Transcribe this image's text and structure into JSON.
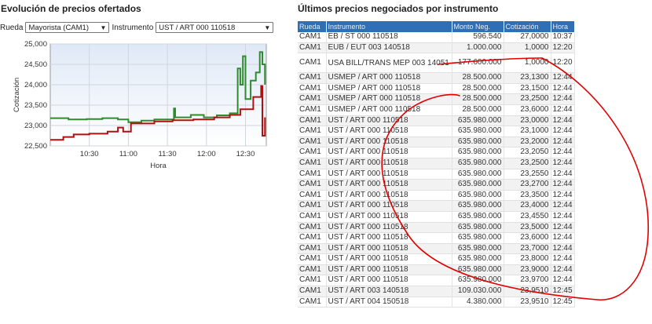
{
  "left_panel": {
    "title": "Evolución de precios ofertados",
    "rueda_label": "Rueda",
    "rueda_value": "Mayorista (CAM1)",
    "instrumento_label": "Instrumento",
    "instrumento_value": "UST / ART 000 110518"
  },
  "right_panel": {
    "title": "Últimos precios negociados por instrumento"
  },
  "chart_data": {
    "type": "line",
    "title": "",
    "xlabel": "Hora",
    "ylabel": "Cotización",
    "x_tick_labels": [
      "10:30",
      "11:00",
      "11:30",
      "12:00",
      "12:30"
    ],
    "y_tick_labels": [
      "22,500",
      "23,000",
      "23,500",
      "24,000",
      "24,500",
      "25,000"
    ],
    "ylim": [
      22500,
      25000
    ],
    "xlim": [
      "10:00",
      "12:46"
    ],
    "grid": true,
    "series": [
      {
        "color": "#2e8b2e",
        "points": [
          [
            "10:00",
            23180
          ],
          [
            "10:14",
            23150
          ],
          [
            "10:28",
            23160
          ],
          [
            "10:40",
            23180
          ],
          [
            "10:52",
            23150
          ],
          [
            "11:00",
            23080
          ],
          [
            "11:10",
            23120
          ],
          [
            "11:20",
            23150
          ],
          [
            "11:30",
            23150
          ],
          [
            "11:35",
            23420
          ],
          [
            "11:36",
            23200
          ],
          [
            "11:48",
            23260
          ],
          [
            "11:58",
            23200
          ],
          [
            "12:08",
            23250
          ],
          [
            "12:18",
            23300
          ],
          [
            "12:24",
            24400
          ],
          [
            "12:26",
            24000
          ],
          [
            "12:28",
            24700
          ],
          [
            "12:30",
            23650
          ],
          [
            "12:34",
            24100
          ],
          [
            "12:38",
            24300
          ],
          [
            "12:41",
            24800
          ],
          [
            "12:43",
            24500
          ],
          [
            "12:45",
            24000
          ]
        ]
      },
      {
        "color": "#b01010",
        "points": [
          [
            "10:00",
            22650
          ],
          [
            "10:06",
            22650
          ],
          [
            "10:10",
            22720
          ],
          [
            "10:18",
            22780
          ],
          [
            "10:30",
            22800
          ],
          [
            "10:44",
            22850
          ],
          [
            "10:52",
            22950
          ],
          [
            "10:56",
            22850
          ],
          [
            "11:02",
            23050
          ],
          [
            "11:20",
            23100
          ],
          [
            "11:34",
            23130
          ],
          [
            "11:50",
            23150
          ],
          [
            "12:06",
            23200
          ],
          [
            "12:18",
            23260
          ],
          [
            "12:26",
            23400
          ],
          [
            "12:36",
            23700
          ],
          [
            "12:42",
            23970
          ],
          [
            "12:43",
            22750
          ],
          [
            "12:45",
            23200
          ]
        ]
      }
    ]
  },
  "table": {
    "headers": [
      "Rueda",
      "Instrumento",
      "Monto Neg.",
      "Cotización",
      "Hora"
    ],
    "rows": [
      [
        "CAM1",
        "EB / ST 000 110518",
        "596.540",
        "27,0000",
        "10:37"
      ],
      [
        "CAM1",
        "EUB / EUT 003 140518",
        "1.000.000",
        "1,0000",
        "12:20"
      ],
      [
        "CAM1",
        "USA BILL/TRANS MEP 003 14051",
        "177.600.000",
        "1,0000",
        "12:20"
      ],
      [
        "CAM1",
        "USMEP / ART 000 110518",
        "28.500.000",
        "23,1300",
        "12:44"
      ],
      [
        "CAM1",
        "USMEP / ART 000 110518",
        "28.500.000",
        "23,1500",
        "12:44"
      ],
      [
        "CAM1",
        "USMEP / ART 000 110518",
        "28.500.000",
        "23,2500",
        "12:44"
      ],
      [
        "CAM1",
        "USMEP / ART 000 110518",
        "28.500.000",
        "23,6000",
        "12:44"
      ],
      [
        "CAM1",
        "UST / ART 000 110518",
        "635.980.000",
        "23,0000",
        "12:44"
      ],
      [
        "CAM1",
        "UST / ART 000 110518",
        "635.980.000",
        "23,1000",
        "12:44"
      ],
      [
        "CAM1",
        "UST / ART 000 110518",
        "635.980.000",
        "23,2000",
        "12:44"
      ],
      [
        "CAM1",
        "UST / ART 000 110518",
        "635.980.000",
        "23,2050",
        "12:44"
      ],
      [
        "CAM1",
        "UST / ART 000 110518",
        "635.980.000",
        "23,2500",
        "12:44"
      ],
      [
        "CAM1",
        "UST / ART 000 110518",
        "635.980.000",
        "23,2550",
        "12:44"
      ],
      [
        "CAM1",
        "UST / ART 000 110518",
        "635.980.000",
        "23,2700",
        "12:44"
      ],
      [
        "CAM1",
        "UST / ART 000 110518",
        "635.980.000",
        "23,3500",
        "12:44"
      ],
      [
        "CAM1",
        "UST / ART 000 110518",
        "635.980.000",
        "23,4000",
        "12:44"
      ],
      [
        "CAM1",
        "UST / ART 000 110518",
        "635.980.000",
        "23,4550",
        "12:44"
      ],
      [
        "CAM1",
        "UST / ART 000 110518",
        "635.980.000",
        "23,5000",
        "12:44"
      ],
      [
        "CAM1",
        "UST / ART 000 110518",
        "635.980.000",
        "23,6000",
        "12:44"
      ],
      [
        "CAM1",
        "UST / ART 000 110518",
        "635.980.000",
        "23,7000",
        "12:44"
      ],
      [
        "CAM1",
        "UST / ART 000 110518",
        "635.980.000",
        "23,8000",
        "12:44"
      ],
      [
        "CAM1",
        "UST / ART 000 110518",
        "635.980.000",
        "23,9000",
        "12:44"
      ],
      [
        "CAM1",
        "UST / ART 000 110518",
        "635.980.000",
        "23,9700",
        "12:44"
      ],
      [
        "CAM1",
        "UST / ART 003 140518",
        "109.030.000",
        "23,9510",
        "12:45"
      ],
      [
        "CAM1",
        "UST / ART 004 150518",
        "4.380.000",
        "23,9510",
        "12:45"
      ]
    ]
  },
  "colors": {
    "header_bg": "#2f6fb5",
    "annotation": "#e00000"
  }
}
